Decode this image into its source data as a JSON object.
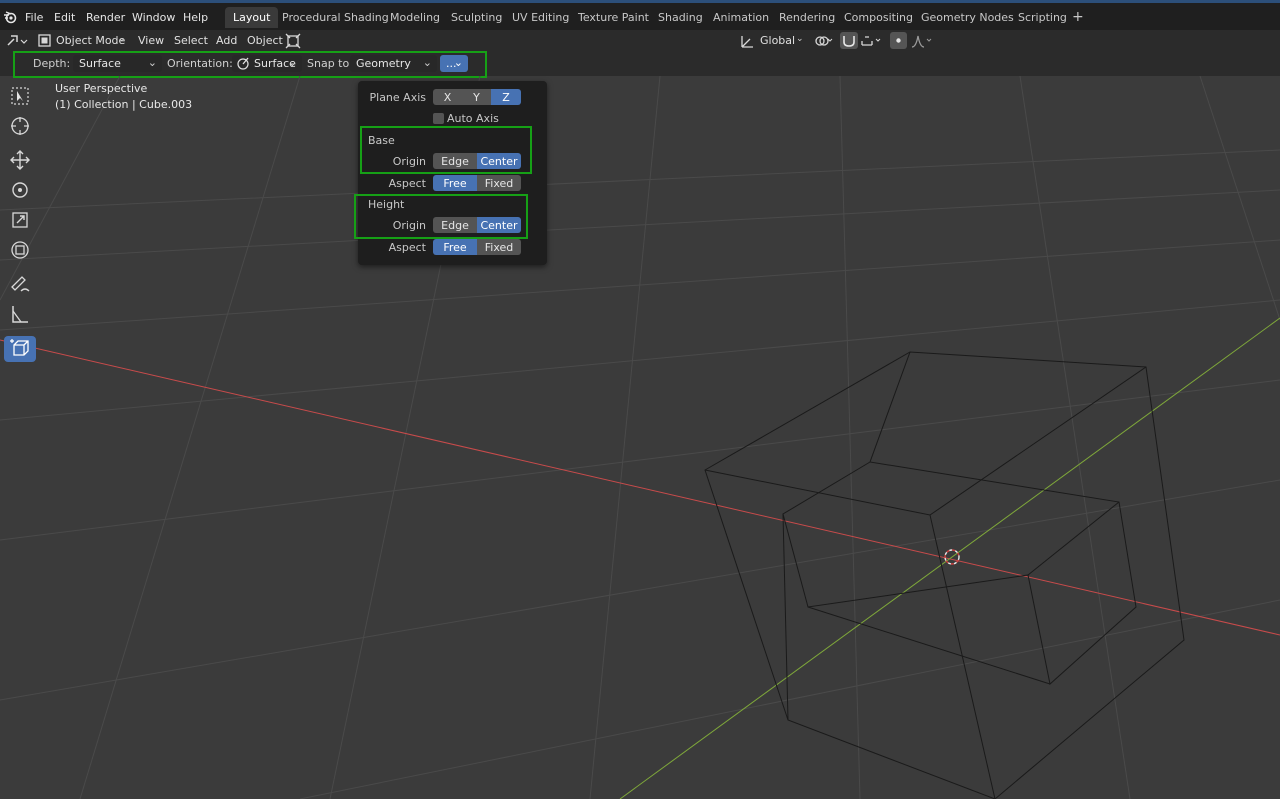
{
  "menu": [
    "File",
    "Edit",
    "Render",
    "Window",
    "Help"
  ],
  "workspace_tabs": [
    "Layout",
    "Procedural Shading",
    "Modeling",
    "Sculpting",
    "UV Editing",
    "Texture Paint",
    "Shading",
    "Animation",
    "Rendering",
    "Compositing",
    "Geometry Nodes",
    "Scripting"
  ],
  "active_tab": "Layout",
  "add_workspace_label": "+",
  "header": {
    "mode": "Object Mode",
    "view": "View",
    "select": "Select",
    "add": "Add",
    "object": "Object",
    "transform_orientation": "Global"
  },
  "tool_settings": {
    "depth_label": "Depth:",
    "depth_value": "Surface",
    "orientation_label": "Orientation:",
    "orientation_value": "Surface",
    "snap_label": "Snap to:",
    "snap_value": "Geometry",
    "more_label": "..."
  },
  "viewport": {
    "perspective": "User Perspective",
    "collection": "(1) Collection | Cube.003"
  },
  "popover": {
    "plane_axis_label": "Plane Axis",
    "plane_axis_options": [
      "X",
      "Y",
      "Z"
    ],
    "plane_axis_selected": "Z",
    "auto_axis_label": "Auto Axis",
    "auto_axis_checked": false,
    "base_heading": "Base",
    "height_heading": "Height",
    "origin_label": "Origin",
    "aspect_label": "Aspect",
    "origin_options": [
      "Edge",
      "Center"
    ],
    "aspect_options": [
      "Free",
      "Fixed"
    ],
    "base_origin": "Center",
    "base_aspect": "Free",
    "height_origin": "Center",
    "height_aspect": "Free"
  },
  "tools": [
    "select-box-icon",
    "cursor-icon",
    "move-icon",
    "rotate-icon",
    "scale-icon",
    "transform-icon",
    "annotate-icon",
    "measure-icon",
    "add-cube-icon"
  ],
  "colors": {
    "accent": "#4772b3",
    "highlight_box": "#16a016",
    "x_axis": "#c84b4b",
    "y_axis": "#7fa83a"
  }
}
